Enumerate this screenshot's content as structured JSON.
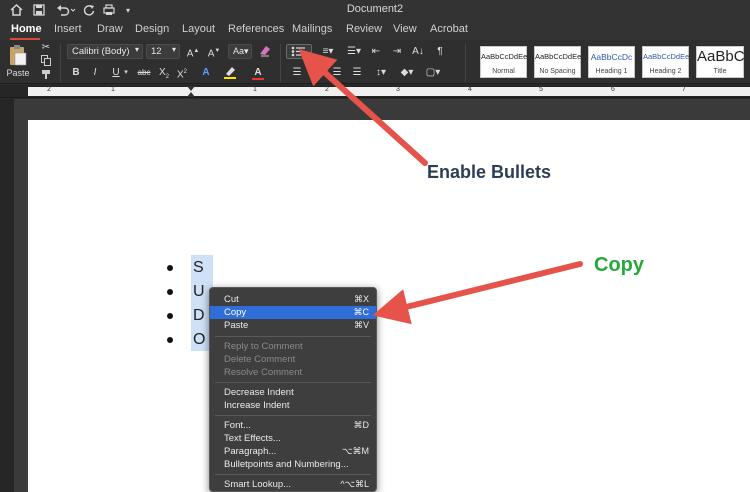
{
  "window": {
    "title": "Document2",
    "quick_access": [
      "home-icon",
      "save-icon",
      "undo-icon",
      "redo-icon",
      "print-icon",
      "customize-icon"
    ]
  },
  "tabs": [
    "Home",
    "Insert",
    "Draw",
    "Design",
    "Layout",
    "References",
    "Mailings",
    "Review",
    "View",
    "Acrobat"
  ],
  "ribbon": {
    "paste_label": "Paste",
    "font_name": "Calibri (Body)",
    "font_size": "12",
    "font_buttons": [
      "B",
      "I",
      "U",
      "abc",
      "X",
      "X"
    ],
    "styles": [
      {
        "sample": "AaBbCcDdEe",
        "name": "Normal"
      },
      {
        "sample": "AaBbCcDdEe",
        "name": "No Spacing"
      },
      {
        "sample": "AaBbCcDc",
        "name": "Heading 1"
      },
      {
        "sample": "AaBbCcDdEe",
        "name": "Heading 2"
      },
      {
        "sample": "AaBbC",
        "name": "Title"
      }
    ]
  },
  "ruler": {
    "numbers": [
      "2",
      "1",
      "1",
      "2",
      "3",
      "4",
      "5",
      "6",
      "7"
    ]
  },
  "document": {
    "bullets": [
      "S",
      "U",
      "D",
      "O"
    ]
  },
  "context_menu": {
    "items": [
      {
        "label": "Cut",
        "shortcut": "⌘X",
        "state": "normal"
      },
      {
        "label": "Copy",
        "shortcut": "⌘C",
        "state": "highlighted"
      },
      {
        "label": "Paste",
        "shortcut": "⌘V",
        "state": "normal"
      },
      {
        "label": "Reply to Comment",
        "shortcut": "",
        "state": "disabled"
      },
      {
        "label": "Delete Comment",
        "shortcut": "",
        "state": "disabled"
      },
      {
        "label": "Resolve Comment",
        "shortcut": "",
        "state": "disabled"
      },
      {
        "label": "Decrease Indent",
        "shortcut": "",
        "state": "normal"
      },
      {
        "label": "Increase Indent",
        "shortcut": "",
        "state": "normal"
      },
      {
        "label": "Font...",
        "shortcut": "⌘D",
        "state": "normal"
      },
      {
        "label": "Text Effects...",
        "shortcut": "",
        "state": "normal"
      },
      {
        "label": "Paragraph...",
        "shortcut": "⌥⌘M",
        "state": "normal"
      },
      {
        "label": "Bulletpoints and Numbering...",
        "shortcut": "",
        "state": "normal"
      },
      {
        "label": "Smart Lookup...",
        "shortcut": "^⌥⌘L",
        "state": "normal"
      }
    ]
  },
  "annotations": {
    "bullets_label": "Enable Bullets",
    "copy_label": "Copy",
    "arrow_color": "#e5534b",
    "bullets_color": "#2c3e55",
    "copy_color": "#27a83a"
  }
}
